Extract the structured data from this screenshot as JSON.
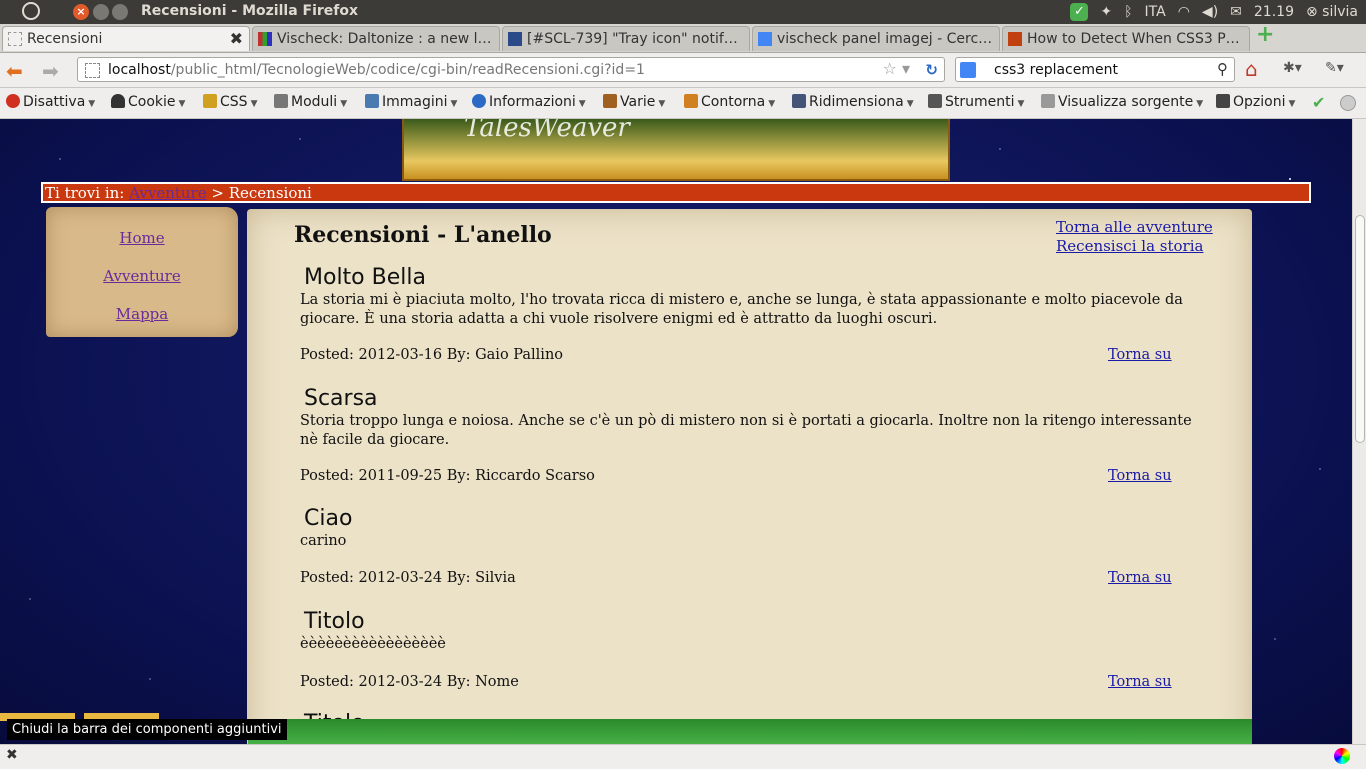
{
  "topbar": {
    "window_title": "Recensioni - Mozilla Firefox",
    "keyboard": "ITA",
    "time": "21.19",
    "user": "silvia"
  },
  "tabs": [
    {
      "label": "Recensioni",
      "favicon_color": "#e8e8e8"
    },
    {
      "label": "Vischeck: Daltonize : a new l…",
      "favicon_color": "#c03030"
    },
    {
      "label": "[#SCL-739] \"Tray icon\" notif…",
      "favicon_color": "#2a4a8a"
    },
    {
      "label": "vischeck panel imagej - Cerc…",
      "favicon_color": "#4285f4"
    },
    {
      "label": "How to Detect When CSS3 P…",
      "favicon_color": "#c04010"
    }
  ],
  "navbar": {
    "url_host": "localhost",
    "url_path": "/public_html/TecnologieWeb/codice/cgi-bin/readRecensioni.cgi?id=1",
    "search_value": "css3 replacement"
  },
  "devbar": [
    {
      "label": "Disattiva",
      "icon": "disable-icon",
      "color": "#d03020"
    },
    {
      "label": "Cookie",
      "icon": "cookie-icon",
      "color": "#333333"
    },
    {
      "label": "CSS",
      "icon": "css-icon",
      "color": "#d0a020"
    },
    {
      "label": "Moduli",
      "icon": "forms-icon",
      "color": "#777777"
    },
    {
      "label": "Immagini",
      "icon": "images-icon",
      "color": "#4a7ab0"
    },
    {
      "label": "Informazioni",
      "icon": "info-icon",
      "color": "#2a6ac5"
    },
    {
      "label": "Varie",
      "icon": "misc-icon",
      "color": "#a06020"
    },
    {
      "label": "Contorna",
      "icon": "outline-icon",
      "color": "#d08020"
    },
    {
      "label": "Ridimensiona",
      "icon": "resize-icon",
      "color": "#445577"
    },
    {
      "label": "Strumenti",
      "icon": "tools-icon",
      "color": "#555555"
    },
    {
      "label": "Visualizza sorgente",
      "icon": "source-icon",
      "color": "#999999"
    },
    {
      "label": "Opzioni",
      "icon": "options-icon",
      "color": "#444444"
    }
  ],
  "page": {
    "banner_title": "TalesWeaver",
    "breadcrumb_prefix": "Ti trovi in:",
    "breadcrumb_link": "Avventure",
    "breadcrumb_sep": ">",
    "breadcrumb_current": "Recensioni",
    "sidenav": [
      "Home",
      "Avventure",
      "Mappa"
    ],
    "title": "Recensioni - L'anello",
    "link_back": "Torna alle avventure",
    "link_review": "Recensisci la storia",
    "to_top_label": "Torna su",
    "reviews": [
      {
        "title": "Molto Bella",
        "body": "La storia mi è piaciuta molto, l'ho trovata ricca di mistero e, anche se lunga, è stata appassionante e molto piacevole da giocare. È una storia adatta a chi vuole risolvere enigmi ed è attratto da luoghi oscuri.",
        "meta": "Posted: 2012-03-16 By: Gaio Pallino"
      },
      {
        "title": "Scarsa",
        "body": "Storia troppo lunga e noiosa. Anche se c'è un pò di mistero non si è portati a giocarla. Inoltre non la ritengo interessante nè facile da giocare.",
        "meta": "Posted: 2011-09-25 By: Riccardo Scarso"
      },
      {
        "title": "Ciao",
        "body": "carino",
        "meta": "Posted: 2012-03-24 By: Silvia"
      },
      {
        "title": "Titolo",
        "body": "èèèèèèèèèèèèèèèèè",
        "meta": "Posted: 2012-03-24 By: Nome"
      },
      {
        "title": "Titolo",
        "body": "",
        "meta": ""
      }
    ]
  },
  "addonbar": {
    "tooltip": "Chiudi la barra dei componenti aggiuntivi"
  }
}
